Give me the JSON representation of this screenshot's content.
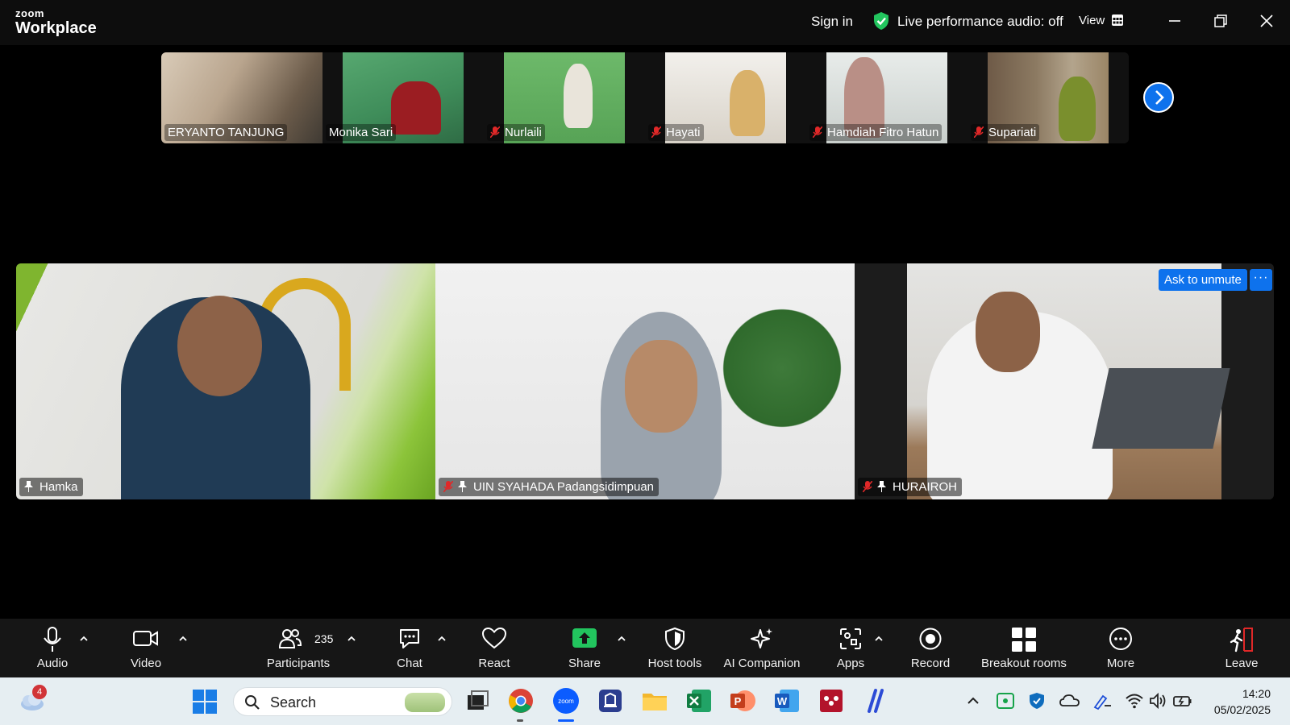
{
  "titlebar": {
    "logo_line1": "zoom",
    "logo_line2": "Workplace",
    "sign_in": "Sign in",
    "live_audio": "Live performance audio: off",
    "view": "View"
  },
  "gallery": {
    "participants": [
      {
        "name": "ERYANTO TANJUNG",
        "muted": false
      },
      {
        "name": "Monika Sari",
        "muted": false
      },
      {
        "name": "Nurlaili",
        "muted": true
      },
      {
        "name": "Hayati",
        "muted": true
      },
      {
        "name": "Hamdiah Fitro Hatun",
        "muted": true
      },
      {
        "name": "Supariati",
        "muted": true
      }
    ]
  },
  "main": {
    "tiles": [
      {
        "name": "Hamka",
        "muted": false,
        "pinned": true
      },
      {
        "name": "UIN SYAHADA Padangsidimpuan",
        "muted": true,
        "pinned": true
      },
      {
        "name": "HURAIROH",
        "muted": true,
        "pinned": true
      }
    ],
    "ask_to_unmute": "Ask to unmute",
    "more_options": "···"
  },
  "toolbar": {
    "audio": "Audio",
    "video": "Video",
    "participants": "Participants",
    "participant_count": "235",
    "chat": "Chat",
    "react": "React",
    "share": "Share",
    "host_tools": "Host tools",
    "ai_companion": "AI Companion",
    "apps": "Apps",
    "record": "Record",
    "breakout_rooms": "Breakout rooms",
    "more": "More",
    "leave": "Leave"
  },
  "taskbar": {
    "weather_badge": "4",
    "search_placeholder": "Search",
    "time": "14:20",
    "date": "05/02/2025"
  },
  "colors": {
    "accent_blue": "#0e72ed",
    "mute_red": "#e02828",
    "share_green": "#22c55e"
  }
}
